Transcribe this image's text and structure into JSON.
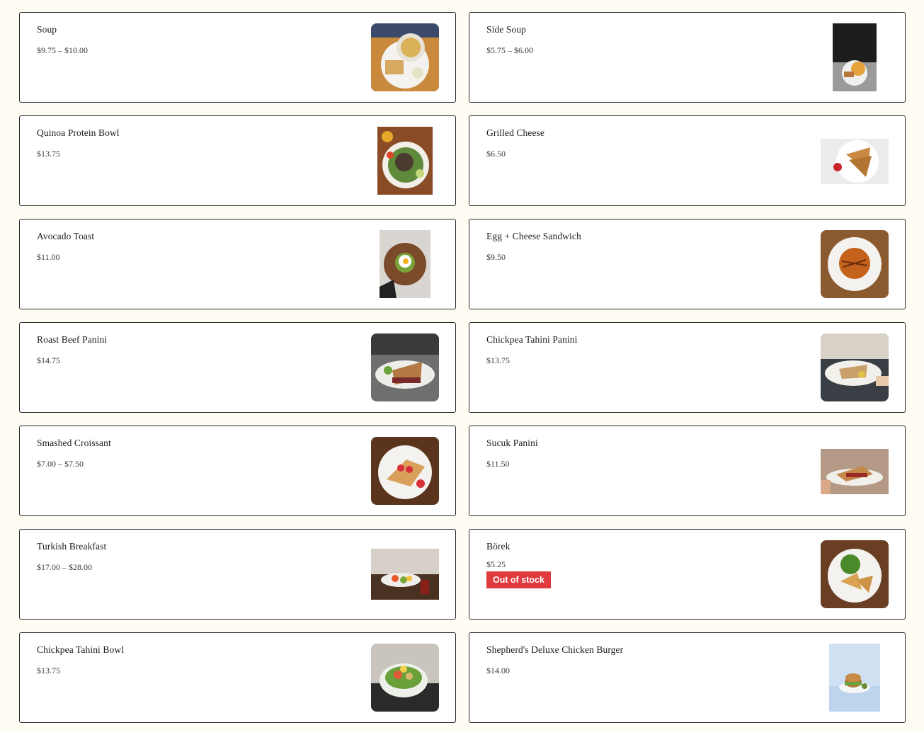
{
  "items": [
    {
      "name": "Soup",
      "price": "$9.75 – $10.00",
      "image": "soup-photo-icon"
    },
    {
      "name": "Side Soup",
      "price": "$5.75 – $6.00",
      "image": "side-soup-photo-icon"
    },
    {
      "name": "Quinoa Protein Bowl",
      "price": "$13.75",
      "image": "quinoa-bowl-photo-icon"
    },
    {
      "name": "Grilled Cheese",
      "price": "$6.50",
      "image": "grilled-cheese-photo-icon"
    },
    {
      "name": "Avocado Toast",
      "price": "$11.00",
      "image": "avocado-toast-photo-icon"
    },
    {
      "name": "Egg + Cheese Sandwich",
      "price": "$9.50",
      "image": "egg-cheese-sandwich-photo-icon"
    },
    {
      "name": "Roast Beef Panini",
      "price": "$14.75",
      "image": "roast-beef-panini-photo-icon"
    },
    {
      "name": "Chickpea Tahini Panini",
      "price": "$13.75",
      "image": "chickpea-panini-photo-icon"
    },
    {
      "name": "Smashed Croissant",
      "price": "$7.00 – $7.50",
      "image": "croissant-photo-icon"
    },
    {
      "name": "Sucuk Panini",
      "price": "$11.50",
      "image": "sucuk-panini-photo-icon"
    },
    {
      "name": "Turkish Breakfast",
      "price": "$17.00 – $28.00",
      "image": "turkish-breakfast-photo-icon"
    },
    {
      "name": "Börek",
      "price": "$5.25",
      "image": "borek-photo-icon",
      "badge": "Out of stock"
    },
    {
      "name": "Chickpea Tahini Bowl",
      "price": "$13.75",
      "image": "chickpea-bowl-photo-icon"
    },
    {
      "name": "Shepherd's Deluxe Chicken Burger",
      "price": "$14.00",
      "image": "chicken-burger-photo-icon"
    }
  ],
  "colors": {
    "page_background": "#fffcf3",
    "card_border": "#2a2a2a",
    "badge_background": "#e03a3e",
    "badge_text": "#ffffff"
  }
}
